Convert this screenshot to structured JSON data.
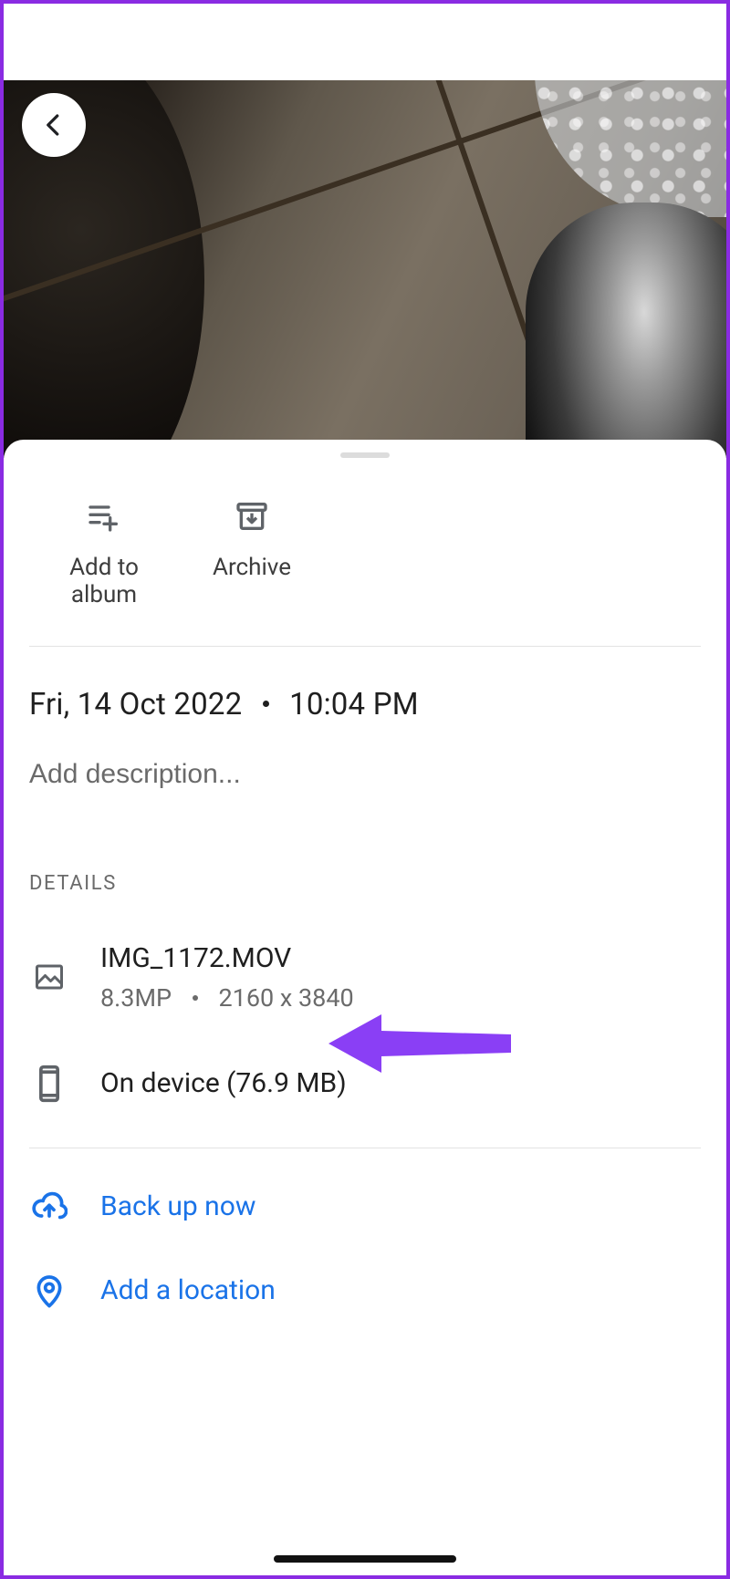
{
  "actions": {
    "add_to_album": "Add to album",
    "archive": "Archive"
  },
  "datetime": {
    "date": "Fri, 14 Oct 2022",
    "time": "10:04 PM"
  },
  "description_placeholder": "Add description...",
  "section_details": "DETAILS",
  "file": {
    "name": "IMG_1172.MOV",
    "megapixels": "8.3MP",
    "dimensions": "2160 x 3840"
  },
  "storage": {
    "label": "On device (76.9 MB)"
  },
  "links": {
    "backup": "Back up now",
    "add_location": "Add a location"
  }
}
